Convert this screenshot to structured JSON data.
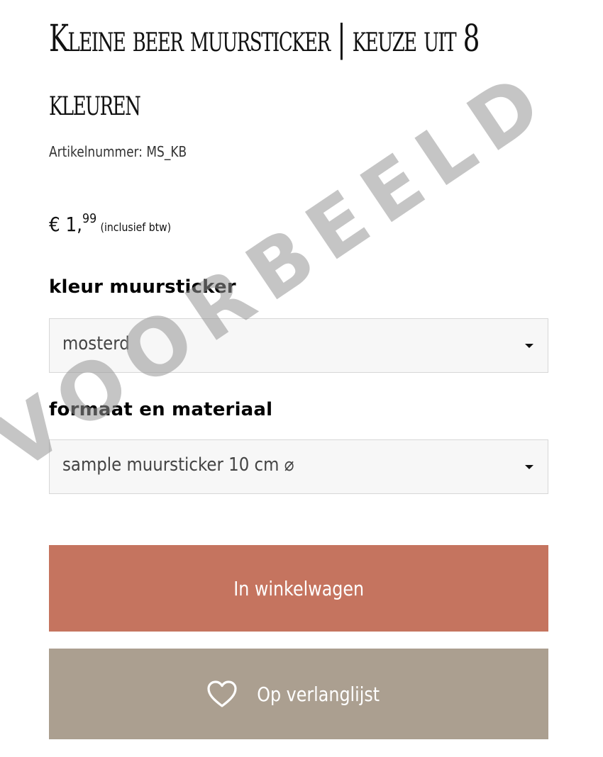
{
  "product": {
    "title": "Kleine beer muursticker | keuze uit 8 kleuren",
    "sku_text": "Artikelnummer: MS_KB",
    "price": {
      "euro": "€ 1,",
      "cents": "99",
      "vat_note": "(inclusief btw)"
    }
  },
  "options": {
    "color": {
      "label": "kleur muursticker",
      "selected": "mosterd"
    },
    "format": {
      "label": "formaat en materiaal",
      "selected": "sample muursticker 10 cm ⌀"
    }
  },
  "actions": {
    "cart_label": "In winkelwagen",
    "wishlist_label": "Op verlanglijst",
    "wishlist_icon": "heart-icon",
    "cart_color": "#c5745f",
    "wishlist_color": "#ab9f90"
  },
  "watermark": "VOORBEELD"
}
